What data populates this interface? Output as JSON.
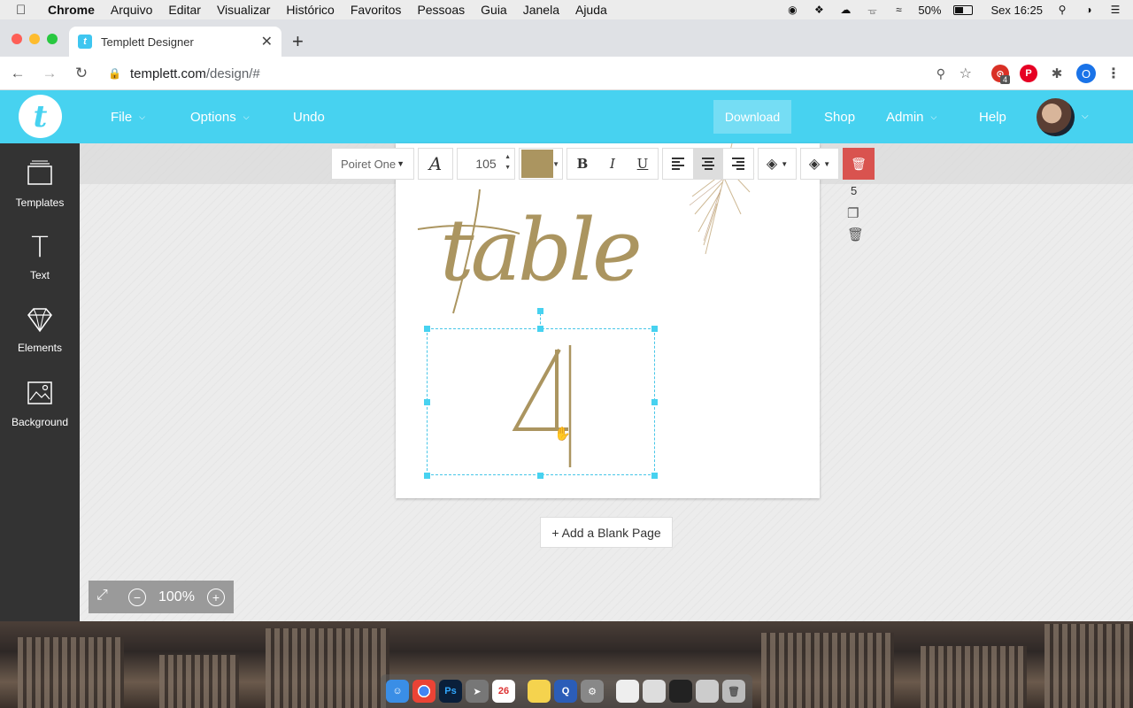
{
  "mac_menubar": {
    "app": "Chrome",
    "menus": [
      "Arquivo",
      "Editar",
      "Visualizar",
      "Histórico",
      "Favoritos",
      "Pessoas",
      "Guia",
      "Janela",
      "Ajuda"
    ],
    "battery": "50%",
    "clock": "Sex 16:25"
  },
  "browser": {
    "tab_title": "Templett Designer",
    "url_host": "templett.com",
    "url_path": "/design/#",
    "ext_badge": "4",
    "profile_initial": "O"
  },
  "header": {
    "nav": [
      {
        "label": "File",
        "has_caret": true
      },
      {
        "label": "Options",
        "has_caret": true
      },
      {
        "label": "Undo",
        "has_caret": false
      }
    ],
    "download": "Download",
    "shop": "Shop",
    "admin": "Admin",
    "help": "Help"
  },
  "sidebar": {
    "items": [
      {
        "label": "Templates",
        "icon": "templates-icon"
      },
      {
        "label": "Text",
        "icon": "text-icon"
      },
      {
        "label": "Elements",
        "icon": "diamond-icon"
      },
      {
        "label": "Background",
        "icon": "image-icon"
      }
    ]
  },
  "format_toolbar": {
    "font": "Poiret One",
    "font_size": "105",
    "color": "#ab9560",
    "bold": "B",
    "italic": "I",
    "underline": "U"
  },
  "canvas": {
    "script_text": "table",
    "number_text": "4",
    "accent_color": "#ab9560",
    "page_number": "5"
  },
  "add_page": "+ Add a Blank Page",
  "zoom": "100%"
}
